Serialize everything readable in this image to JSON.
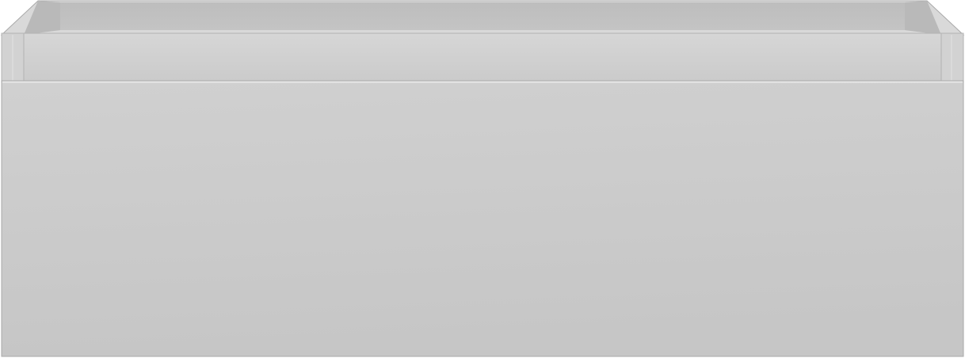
{
  "object": {
    "icon": "open-box-drawer-icon",
    "colors": {
      "background": "#ffffff",
      "inner_back_wall": "#c4c4c4",
      "inner_side_wall": "#b9b9b9",
      "inner_shadow": "#adadad",
      "top_rim": "#d9d9d9",
      "inner_rim_face": "#cfcfcf",
      "side_post": "#d2d2d2",
      "front_panel_top": "#d0d0d0",
      "front_panel_bottom": "#c6c6c6",
      "edge_highlight": "#e8e8e8",
      "outline": "#a9a9a9"
    }
  }
}
